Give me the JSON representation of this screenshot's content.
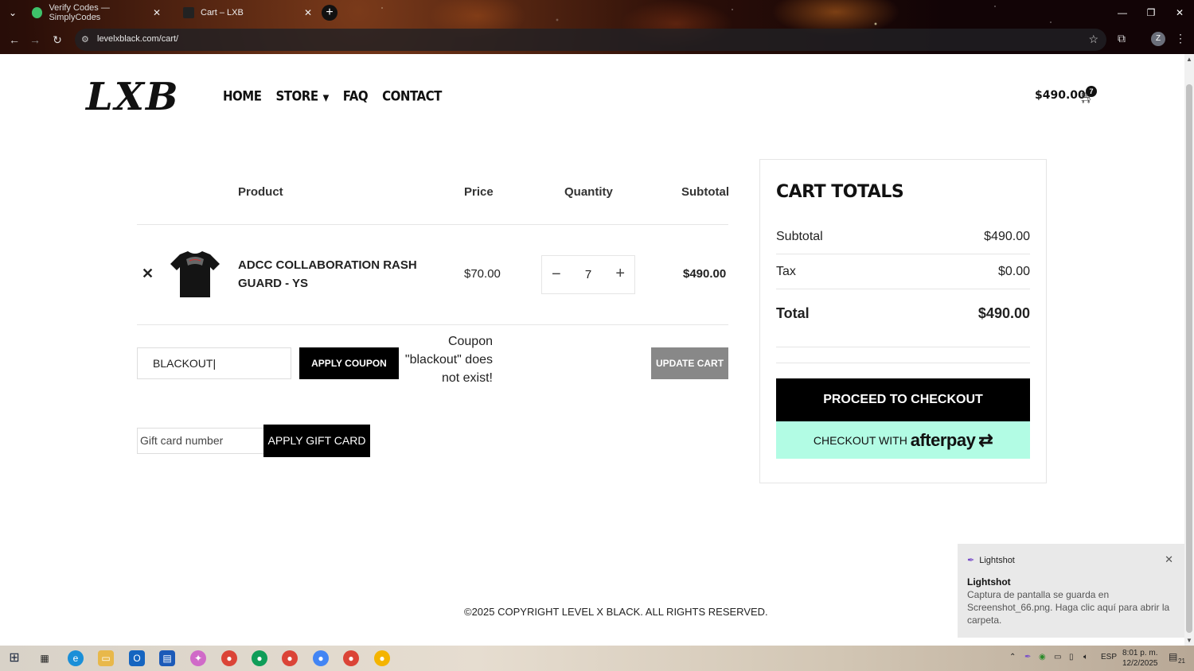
{
  "browser": {
    "tabs": [
      {
        "title": "Verify Codes — SimplyCodes",
        "active": false
      },
      {
        "title": "Cart – LXB",
        "active": true
      }
    ],
    "url": "levelxblack.com/cart/",
    "profile_initial": "Z"
  },
  "site": {
    "logo": "LXB",
    "nav": [
      {
        "label": "HOME"
      },
      {
        "label": "STORE",
        "has_dropdown": true
      },
      {
        "label": "FAQ"
      },
      {
        "label": "CONTACT"
      }
    ],
    "header_cart_total": "$490.00",
    "cart_count": "7"
  },
  "cart": {
    "headers": {
      "product": "Product",
      "price": "Price",
      "quantity": "Quantity",
      "subtotal": "Subtotal"
    },
    "items": [
      {
        "name": "ADCC COLLABORATION RASH GUARD - YS",
        "price": "$70.00",
        "quantity": "7",
        "subtotal": "$490.00"
      }
    ],
    "coupon_value": "BLACKOUT",
    "apply_coupon_label": "APPLY COUPON",
    "coupon_error": "Coupon \"blackout\" does not exist!",
    "update_cart_label": "UPDATE CART",
    "gift_placeholder": "Gift card number",
    "apply_gift_label": "APPLY GIFT CARD"
  },
  "totals": {
    "title": "CART TOTALS",
    "subtotal_label": "Subtotal",
    "subtotal_value": "$490.00",
    "tax_label": "Tax",
    "tax_value": "$0.00",
    "total_label": "Total",
    "total_value": "$490.00",
    "checkout_label": "PROCEED TO CHECKOUT",
    "afterpay_prefix": "CHECKOUT WITH",
    "afterpay_brand": "afterpay"
  },
  "footer": {
    "copyright": "©2025 COPYRIGHT LEVEL X BLACK. ALL RIGHTS RESERVED."
  },
  "notification": {
    "app": "Lightshot",
    "title": "Lightshot",
    "body": "Captura de pantalla se guarda en Screenshot_66.png. Haga clic aquí para abrir la carpeta."
  },
  "taskbar": {
    "language": "ESP",
    "time": "8:01 p. m.",
    "date": "12/2/2025",
    "notification_count": "21"
  }
}
